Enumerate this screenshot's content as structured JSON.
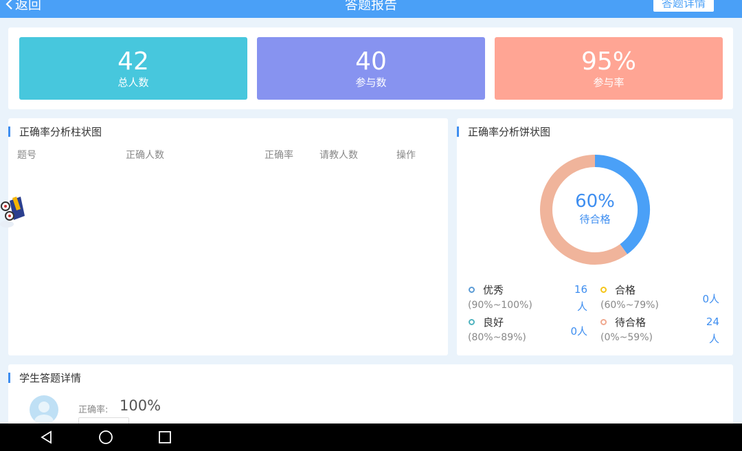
{
  "header": {
    "back_label": "返回",
    "title": "答题报告",
    "detail_label": "答题详情"
  },
  "stats": [
    {
      "value": "42",
      "label": "总人数",
      "color": "#47c7dd"
    },
    {
      "value": "40",
      "label": "参与数",
      "color": "#8793f0"
    },
    {
      "value": "95%",
      "label": "参与率",
      "color": "#ffa594"
    }
  ],
  "bar_section": {
    "title": "正确率分析柱状图",
    "columns": [
      "题号",
      "正确人数",
      "正确率",
      "请教人数",
      "操作"
    ]
  },
  "pie_section": {
    "title": "正确率分析饼状图",
    "center_value": "60%",
    "center_label": "待合格",
    "legend": [
      {
        "name": "优秀",
        "range": "(90%~100%)",
        "count": "16",
        "unit": "人",
        "color": "#5b9bd5"
      },
      {
        "name": "合格",
        "range": "(60%~79%)",
        "count": "0人",
        "color": "#f5c518"
      },
      {
        "name": "良好",
        "range": "(80%~89%)",
        "count": "0人",
        "color": "#4fb3bf"
      },
      {
        "name": "待合格",
        "range": "(0%~59%)",
        "count": "24",
        "unit": "人",
        "color": "#f0a88f"
      }
    ]
  },
  "chart_data": {
    "type": "pie",
    "categories": [
      "优秀",
      "合格",
      "良好",
      "待合格"
    ],
    "values": [
      16,
      0,
      0,
      24
    ],
    "colors": [
      "#4aa0f7",
      "#f5c518",
      "#4fb3bf",
      "#f0b49b"
    ],
    "center_text": "60%",
    "center_label": "待合格"
  },
  "student_section": {
    "title": "学生答题详情",
    "rate_label": "正确率:",
    "rate_value": "100%"
  }
}
